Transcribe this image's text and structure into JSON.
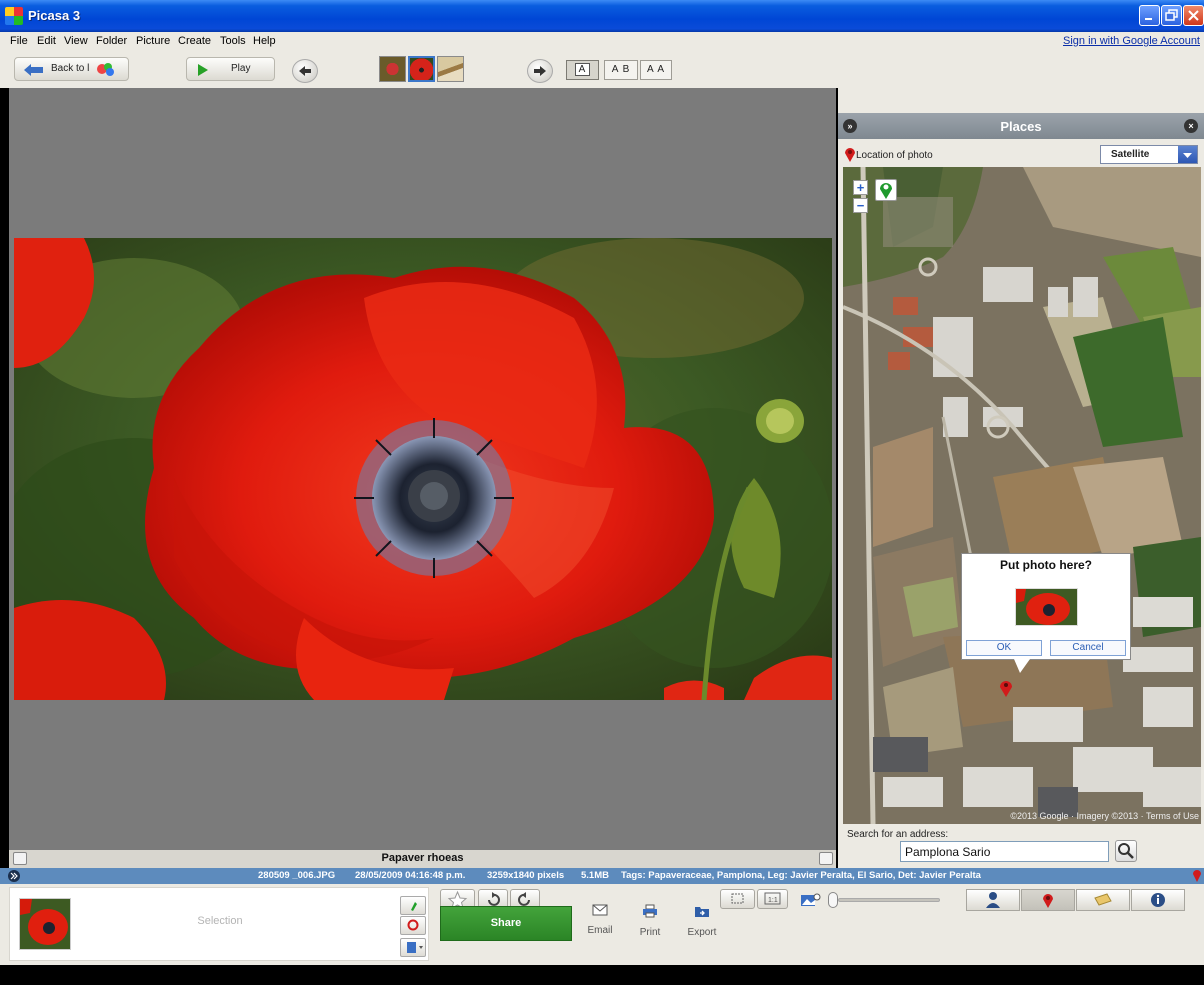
{
  "window": {
    "title": "Picasa 3"
  },
  "menu": {
    "items": [
      "File",
      "Edit",
      "View",
      "Folder",
      "Picture",
      "Create",
      "Tools",
      "Help"
    ],
    "signin": "Sign in with Google Account"
  },
  "toolbar": {
    "back_label": "Back to l",
    "play_label": "Play",
    "view_single": "A",
    "view_compare": "A B",
    "view_mirror": "A A"
  },
  "photo": {
    "caption": "Papaver rhoeas"
  },
  "places": {
    "title": "Places",
    "location_label": "Location of photo",
    "map_type": "Satellite",
    "attribution": "©2013 Google · Imagery ©2013 · Terms of Use",
    "popup": {
      "title": "Put photo here?",
      "ok": "OK",
      "cancel": "Cancel"
    },
    "search_label": "Search for an address:",
    "search_value": "Pamplona Sario"
  },
  "info": {
    "filename": "280509 _006.JPG",
    "datetime": "28/05/2009 04:16:48 p.m.",
    "dimensions": "3259x1840 pixels",
    "size": "5.1MB",
    "tags": "Tags: Papaveraceae, Pamplona, Leg: Javier Peralta, El Sario, Det: Javier Peralta"
  },
  "tray": {
    "selection_label": "Selection",
    "share_label": "Share",
    "email_label": "Email",
    "print_label": "Print",
    "export_label": "Export"
  },
  "colors": {
    "accent": "#5d8bbd",
    "share": "#359a2f",
    "titlebar": "#0046d5"
  }
}
